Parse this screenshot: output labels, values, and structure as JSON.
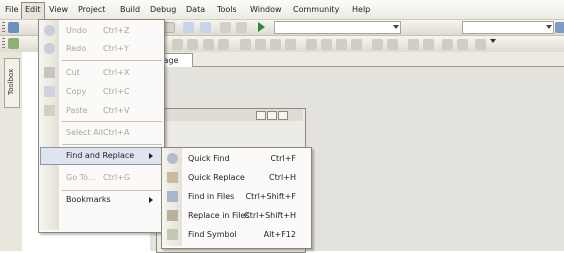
{
  "menubar": {
    "items": [
      {
        "label": "File"
      },
      {
        "label": "Edit"
      },
      {
        "label": "View"
      },
      {
        "label": "Project"
      },
      {
        "label": "Build"
      },
      {
        "label": "Debug"
      },
      {
        "label": "Data"
      },
      {
        "label": "Tools"
      },
      {
        "label": "Window"
      },
      {
        "label": "Community"
      },
      {
        "label": "Help"
      }
    ]
  },
  "toolbox": {
    "label": "Toolbox"
  },
  "document": {
    "tab_label": "Page"
  },
  "edit_menu": {
    "items": [
      {
        "label": "Undo",
        "shortcut": "Ctrl+Z",
        "icon": "undo-icon",
        "enabled": false
      },
      {
        "label": "Redo",
        "shortcut": "Ctrl+Y",
        "icon": "redo-icon",
        "enabled": false
      },
      {
        "label": "Cut",
        "shortcut": "Ctrl+X",
        "icon": "cut-icon",
        "enabled": false
      },
      {
        "label": "Copy",
        "shortcut": "Ctrl+C",
        "icon": "copy-icon",
        "enabled": false
      },
      {
        "label": "Paste",
        "shortcut": "Ctrl+V",
        "icon": "paste-icon",
        "enabled": false
      },
      {
        "label": "Select All",
        "shortcut": "Ctrl+A",
        "icon": "",
        "enabled": false
      },
      {
        "label": "Find and Replace",
        "shortcut": "",
        "icon": "",
        "enabled": true,
        "submenu": true
      },
      {
        "label": "Go To...",
        "shortcut": "Ctrl+G",
        "icon": "",
        "enabled": false
      },
      {
        "label": "Bookmarks",
        "shortcut": "",
        "icon": "",
        "enabled": true,
        "submenu": true
      }
    ]
  },
  "find_replace_submenu": {
    "items": [
      {
        "label": "Quick Find",
        "shortcut": "Ctrl+F",
        "icon": "quick-find-icon"
      },
      {
        "label": "Quick Replace",
        "shortcut": "Ctrl+H",
        "icon": "quick-replace-icon"
      },
      {
        "label": "Find in Files",
        "shortcut": "Ctrl+Shift+F",
        "icon": "find-in-files-icon"
      },
      {
        "label": "Replace in Files",
        "shortcut": "Ctrl+Shift+H",
        "icon": "replace-in-files-icon"
      },
      {
        "label": "Find Symbol",
        "shortcut": "Alt+F12",
        "icon": "find-symbol-icon"
      }
    ]
  }
}
